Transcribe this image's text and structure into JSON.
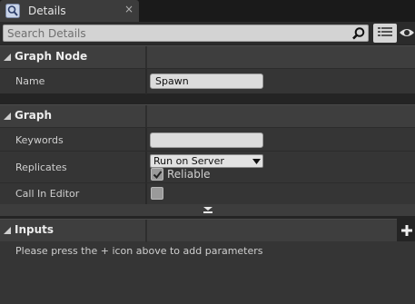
{
  "tab": {
    "title": "Details",
    "icon": "details-magnifier-icon",
    "close": "×"
  },
  "search": {
    "placeholder": "Search Details",
    "value": ""
  },
  "sections": {
    "graph_node": {
      "title": "Graph Node",
      "name_label": "Name",
      "name_value": "Spawn"
    },
    "graph": {
      "title": "Graph",
      "keywords_label": "Keywords",
      "keywords_value": "",
      "replicates_label": "Replicates",
      "replicates_value": "Run on Server",
      "reliable_label": "Reliable",
      "reliable_checked": true,
      "call_in_editor_label": "Call In Editor",
      "call_in_editor_checked": false
    },
    "inputs": {
      "title": "Inputs",
      "hint": "Please press the + icon above to add parameters"
    }
  },
  "colors": {
    "panel_bg": "#242424",
    "category_bg": "#3e3e3e",
    "row_bg": "#353535",
    "field_bg": "#dcdcdc"
  }
}
